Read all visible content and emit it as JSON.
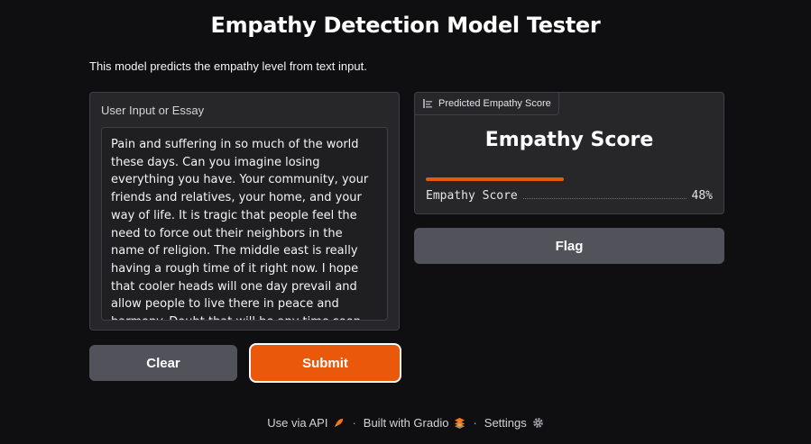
{
  "header": {
    "title": "Empathy Detection Model Tester",
    "description": "This model predicts the empathy level from text input."
  },
  "input": {
    "label": "User Input or Essay",
    "value": "Pain and suffering in so much of the world these days. Can you imagine losing everything you have. Your community, your friends and relatives, your home, and your way of life. It is tragic that people feel the need to force out their neighbors in the name of religion. The middle east is really having a rough time of it right now. I hope that cooler heads will one day prevail and allow people to live there in peace and harmony. Doubt that will be any time soon."
  },
  "buttons": {
    "clear": "Clear",
    "submit": "Submit",
    "flag": "Flag"
  },
  "output": {
    "tag_label": "Predicted Empathy Score",
    "tag_icon": "label-icon",
    "heading": "Empathy Score",
    "confidences": [
      {
        "label": "Empathy Score",
        "percent": "48%",
        "value": 0.48
      }
    ]
  },
  "footer": {
    "api": "Use via API",
    "api_icon": "rocket-icon",
    "built": "Built with Gradio",
    "built_icon": "gradio-logo-icon",
    "settings": "Settings",
    "settings_icon": "gear-icon",
    "separator": "·"
  },
  "colors": {
    "accent": "#ea580c",
    "panel": "#27272a",
    "background": "#0f0f11",
    "secondary_button": "#52525b"
  }
}
